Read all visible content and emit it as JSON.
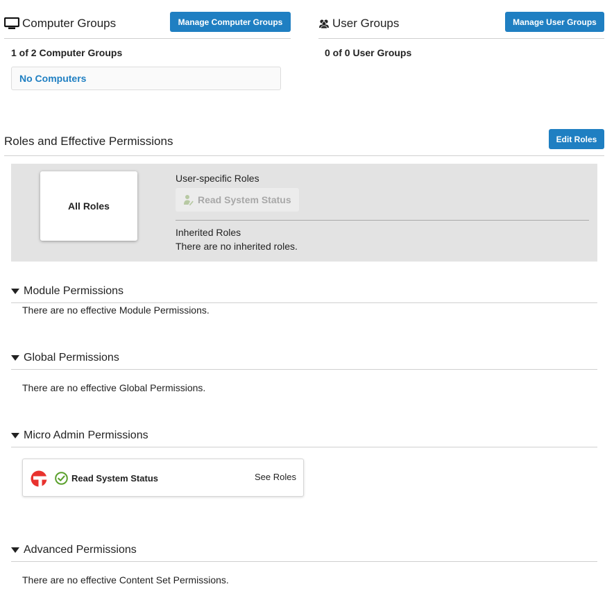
{
  "computer_groups": {
    "title": "Computer Groups",
    "manage_button": "Manage Computer Groups",
    "count": "1 of 2 Computer Groups",
    "empty_item": "No Computers"
  },
  "user_groups": {
    "title": "User Groups",
    "manage_button": "Manage User Groups",
    "count": "0 of 0 User Groups"
  },
  "roles": {
    "title": "Roles and Effective Permissions",
    "edit_button": "Edit Roles",
    "all_roles": "All Roles",
    "user_specific_label": "User-specific Roles",
    "user_specific_role": "Read System Status",
    "inherited_label": "Inherited Roles",
    "inherited_text": "There are no inherited roles."
  },
  "permissions": {
    "module": {
      "title": "Module Permissions",
      "text": "There are no effective Module Permissions."
    },
    "global": {
      "title": "Global Permissions",
      "text": "There are no effective Global Permissions."
    },
    "micro_admin": {
      "title": "Micro Admin Permissions",
      "item_label": "Read System Status",
      "see_roles": "See Roles"
    },
    "advanced": {
      "title": "Advanced Permissions",
      "text": "There are no effective Content Set Permissions."
    }
  },
  "colors": {
    "accent": "#1f7fc2",
    "panel_bg": "#e3e3e3",
    "logo_red": "#e8322e",
    "check_green": "#5aa02c"
  },
  "icons": [
    "monitor-icon",
    "users-icon",
    "user-edit-icon",
    "caret-down-icon",
    "brand-logo-icon",
    "check-circle-icon"
  ]
}
